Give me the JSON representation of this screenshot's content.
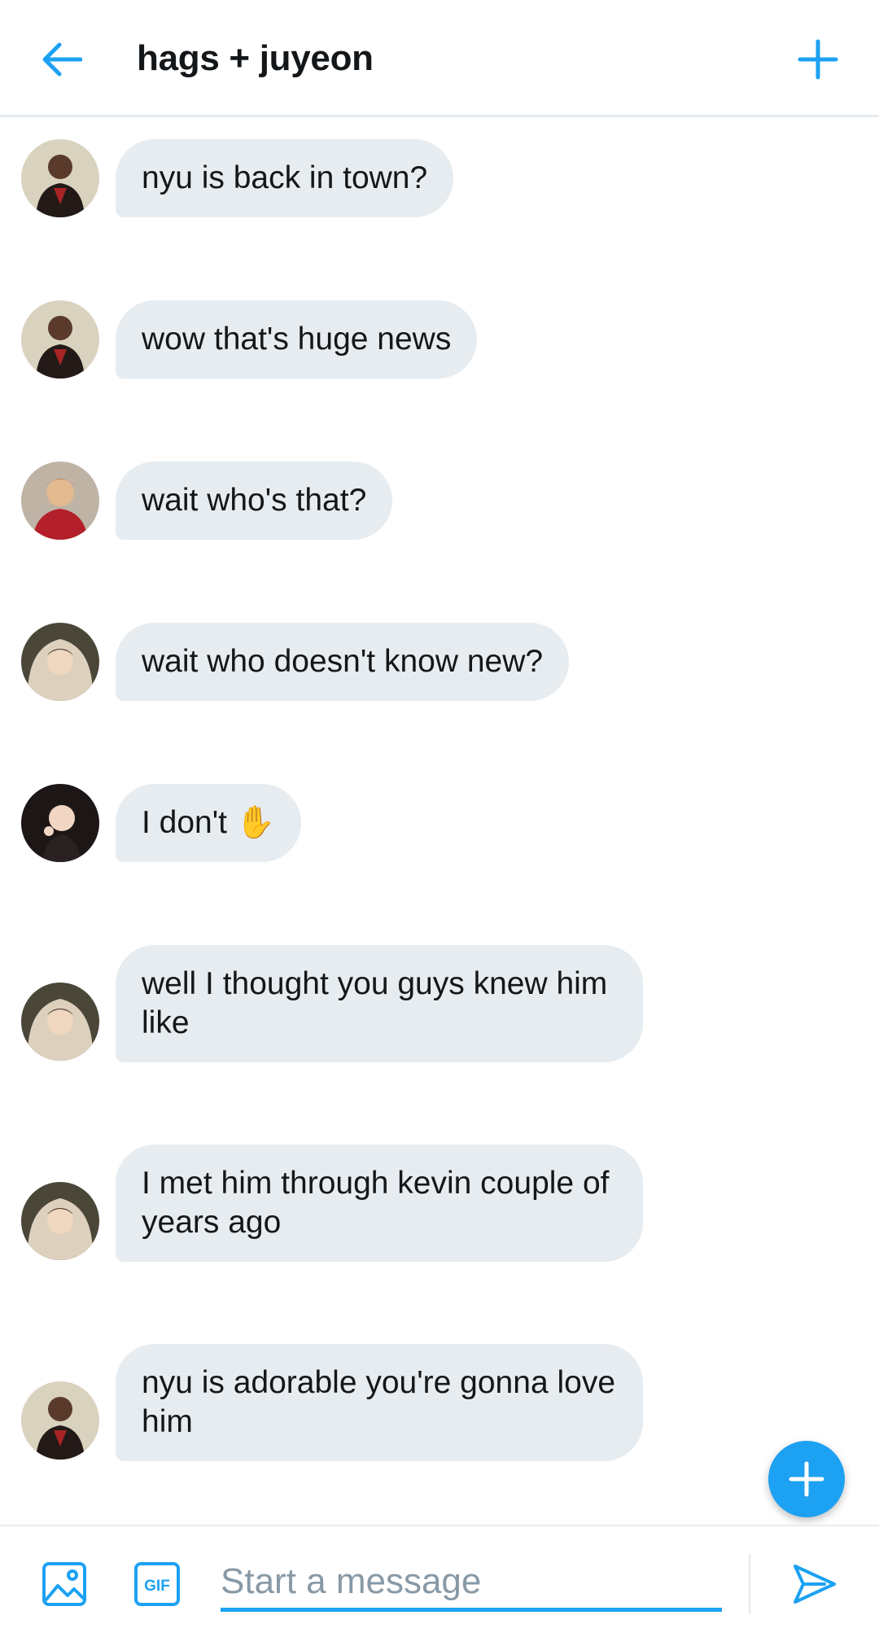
{
  "header": {
    "title": "hags + juyeon",
    "back_icon": "arrow-left-icon",
    "add_icon": "plus-icon"
  },
  "colors": {
    "accent": "#1da1f2",
    "bubble": "#e6ecf0",
    "text": "#14171a",
    "placeholder": "#8899a6"
  },
  "messages": [
    {
      "sender": "avatar-a",
      "text": "nyu is back in town?"
    },
    {
      "sender": "avatar-a",
      "text": "wow that's huge news"
    },
    {
      "sender": "avatar-b",
      "text": "wait who's that?"
    },
    {
      "sender": "avatar-c",
      "text": "wait who doesn't know new?"
    },
    {
      "sender": "avatar-d",
      "text": "I don't ✋"
    },
    {
      "sender": "avatar-c",
      "text": "well I thought you guys knew him like"
    },
    {
      "sender": "avatar-c",
      "text": "I met him through kevin couple of years ago"
    },
    {
      "sender": "avatar-a",
      "text": "nyu is adorable you're gonna love him"
    }
  ],
  "composer": {
    "placeholder": "Start a message",
    "media_icon": "image-icon",
    "gif_label": "GIF",
    "send_icon": "send-icon"
  },
  "fab": {
    "icon": "plus-icon"
  }
}
